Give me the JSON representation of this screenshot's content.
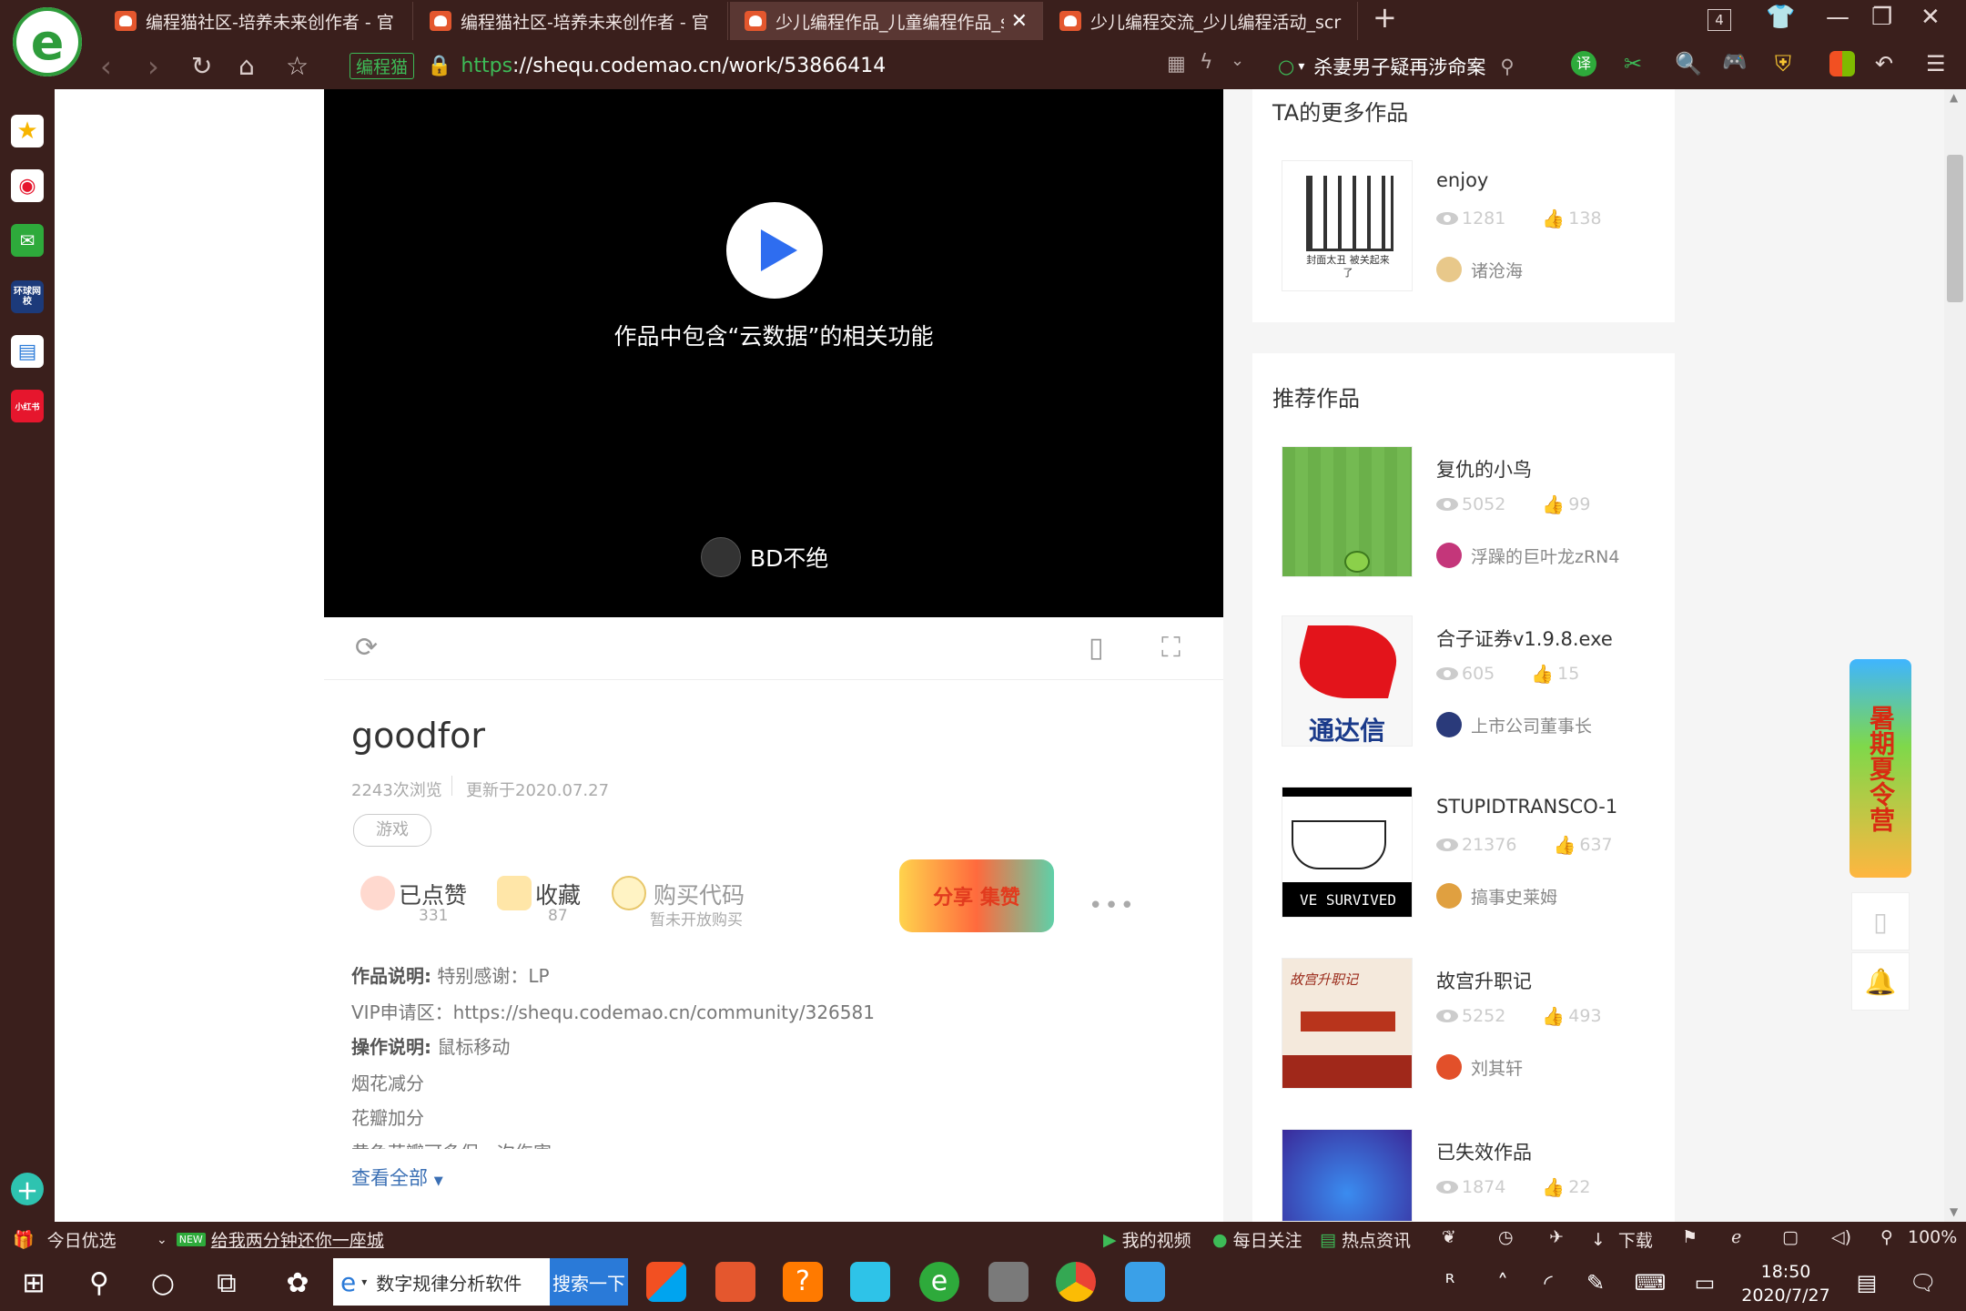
{
  "browser": {
    "tabs": [
      {
        "title": "编程猫社区-培养未来创作者 - 官",
        "active": false
      },
      {
        "title": "编程猫社区-培养未来创作者 - 官",
        "active": false
      },
      {
        "title": "少儿编程作品_儿童编程作品_scra",
        "active": true
      },
      {
        "title": "少儿编程交流_少儿编程活动_scr",
        "active": false
      }
    ],
    "tab_count": "4",
    "site_badge": "编程猫",
    "url_scheme": "https",
    "url_rest": "://shequ.codemao.cn/work/53866414",
    "search_text": "杀妻男子疑再涉命案",
    "translate_label": "译"
  },
  "player": {
    "cloud_message": "作品中包含“云数据”的相关功能",
    "author": "BD不绝"
  },
  "work": {
    "title": "goodfor",
    "views": "2243次浏览",
    "updated": "更新于2020.07.27",
    "tag": "游戏",
    "like_label": "已点赞",
    "like_count": "331",
    "fav_label": "收藏",
    "fav_count": "87",
    "buy_label": "购买代码",
    "buy_sub": "暂未开放购买",
    "share_banner": "分享 集赞",
    "desc_label": "作品说明:",
    "desc_text": "特别感谢：LP",
    "vip_line": "VIP申请区：https://shequ.codemao.cn/community/326581",
    "op_label": "操作说明:",
    "op_text": "鼠标移动",
    "line1": "烟花减分",
    "line2": "花瓣加分",
    "line3": "黄色花瓣可多保一次伤害",
    "view_all": "查看全部"
  },
  "more_works": {
    "title": "TA的更多作品",
    "items": [
      {
        "name": "enjoy",
        "views": "1281",
        "likes": "138",
        "author": "诸沧海",
        "thumb_text": "封面太丑 被关起来了"
      }
    ]
  },
  "recommended": {
    "title": "推荐作品",
    "items": [
      {
        "name": "复仇的小鸟",
        "views": "5052",
        "likes": "99",
        "author": "浮躁的巨叶龙zRN4"
      },
      {
        "name": "合子证券v1.9.8.exe",
        "views": "605",
        "likes": "15",
        "author": "上市公司董事长",
        "thumb_text": "通达信"
      },
      {
        "name": "STUPIDTRANSCO-1",
        "views": "21376",
        "likes": "637",
        "author": "搞事史莱姆",
        "thumb_text": "VE SURVIVED"
      },
      {
        "name": "故宫升职记",
        "views": "5252",
        "likes": "493",
        "author": "刘其轩",
        "thumb_text": "故宫升职记"
      },
      {
        "name": "已失效作品",
        "views": "1874",
        "likes": "22"
      }
    ]
  },
  "promo": {
    "text": "暑期夏令营"
  },
  "statusbar": {
    "today": "今日优选",
    "news": "给我两分钟还你一座城",
    "new_badge": "NEW",
    "my_video": "我的视频",
    "daily": "每日关注",
    "hot": "热点资讯",
    "download": "下载",
    "zoom": "100%"
  },
  "taskbar": {
    "search_text": "数字规律分析软件",
    "search_btn": "搜索一下",
    "time": "18:50",
    "date": "2020/7/27"
  },
  "sidebar": {
    "news_icon_text": "环球网校",
    "redbook_icon_text": "小红书"
  }
}
